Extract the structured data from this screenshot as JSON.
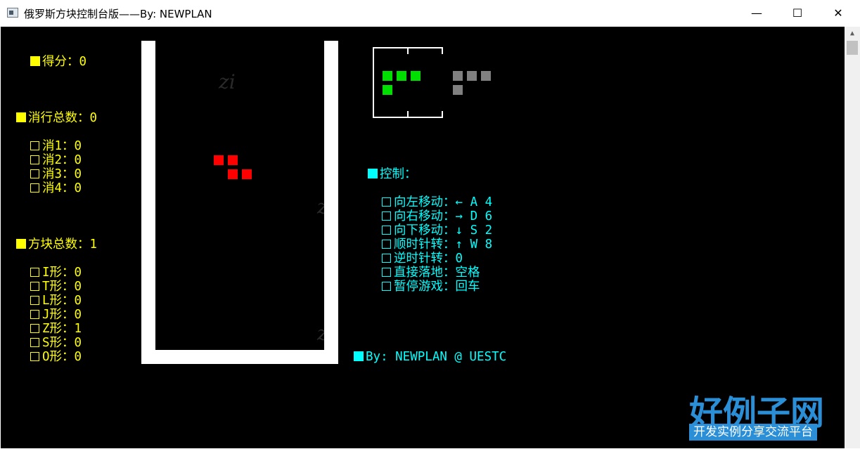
{
  "window": {
    "title": "俄罗斯方块控制台版——By: NEWPLAN",
    "minimize": "—",
    "maximize": "☐",
    "close": "✕"
  },
  "stats": {
    "score": "得分：0",
    "lines_total": "消行总数：0",
    "lines": [
      "消1：0",
      "消2：0",
      "消3：0",
      "消4：0"
    ],
    "blocks_total": "方块总数：1",
    "shapes": [
      "I形：0",
      "T形：0",
      "L形：0",
      "J形：0",
      "Z形：1",
      "S形：0",
      "O形：0"
    ]
  },
  "controls": {
    "title": "控制：",
    "items": [
      "向左移动：← A 4",
      "向右移动：→ D 6",
      "向下移动：↓ S 2",
      "顺时针转：↑ W 8",
      "逆时针转：0",
      "直接落地：空格",
      "暂停游戏：回车"
    ]
  },
  "credit": "By: NEWPLAN @ UESTC",
  "board": {
    "current_piece": "Z",
    "cells": [
      [
        0,
        0
      ],
      [
        1,
        0
      ],
      [
        1,
        1
      ],
      [
        2,
        1
      ]
    ]
  },
  "preview": {
    "next_piece": "L",
    "next_cells": [
      [
        0,
        0
      ],
      [
        1,
        0
      ],
      [
        2,
        0
      ],
      [
        0,
        1
      ]
    ],
    "ghost_cells": [
      [
        0,
        0
      ],
      [
        1,
        0
      ],
      [
        2,
        0
      ],
      [
        0,
        1
      ]
    ]
  },
  "watermark": {
    "main": "好例子网",
    "sub": "开发实例分享交流平台"
  },
  "colors": {
    "console_bg": "#000000",
    "stats_text": "#ffff00",
    "controls_text": "#00ffff",
    "current_piece": "#ff0000",
    "next_piece": "#00e000",
    "ghost_piece": "#808080",
    "well_wall": "#ffffff"
  },
  "icons": {
    "app": "console-app-icon",
    "scroll_up": "scroll-up-arrow-icon"
  }
}
